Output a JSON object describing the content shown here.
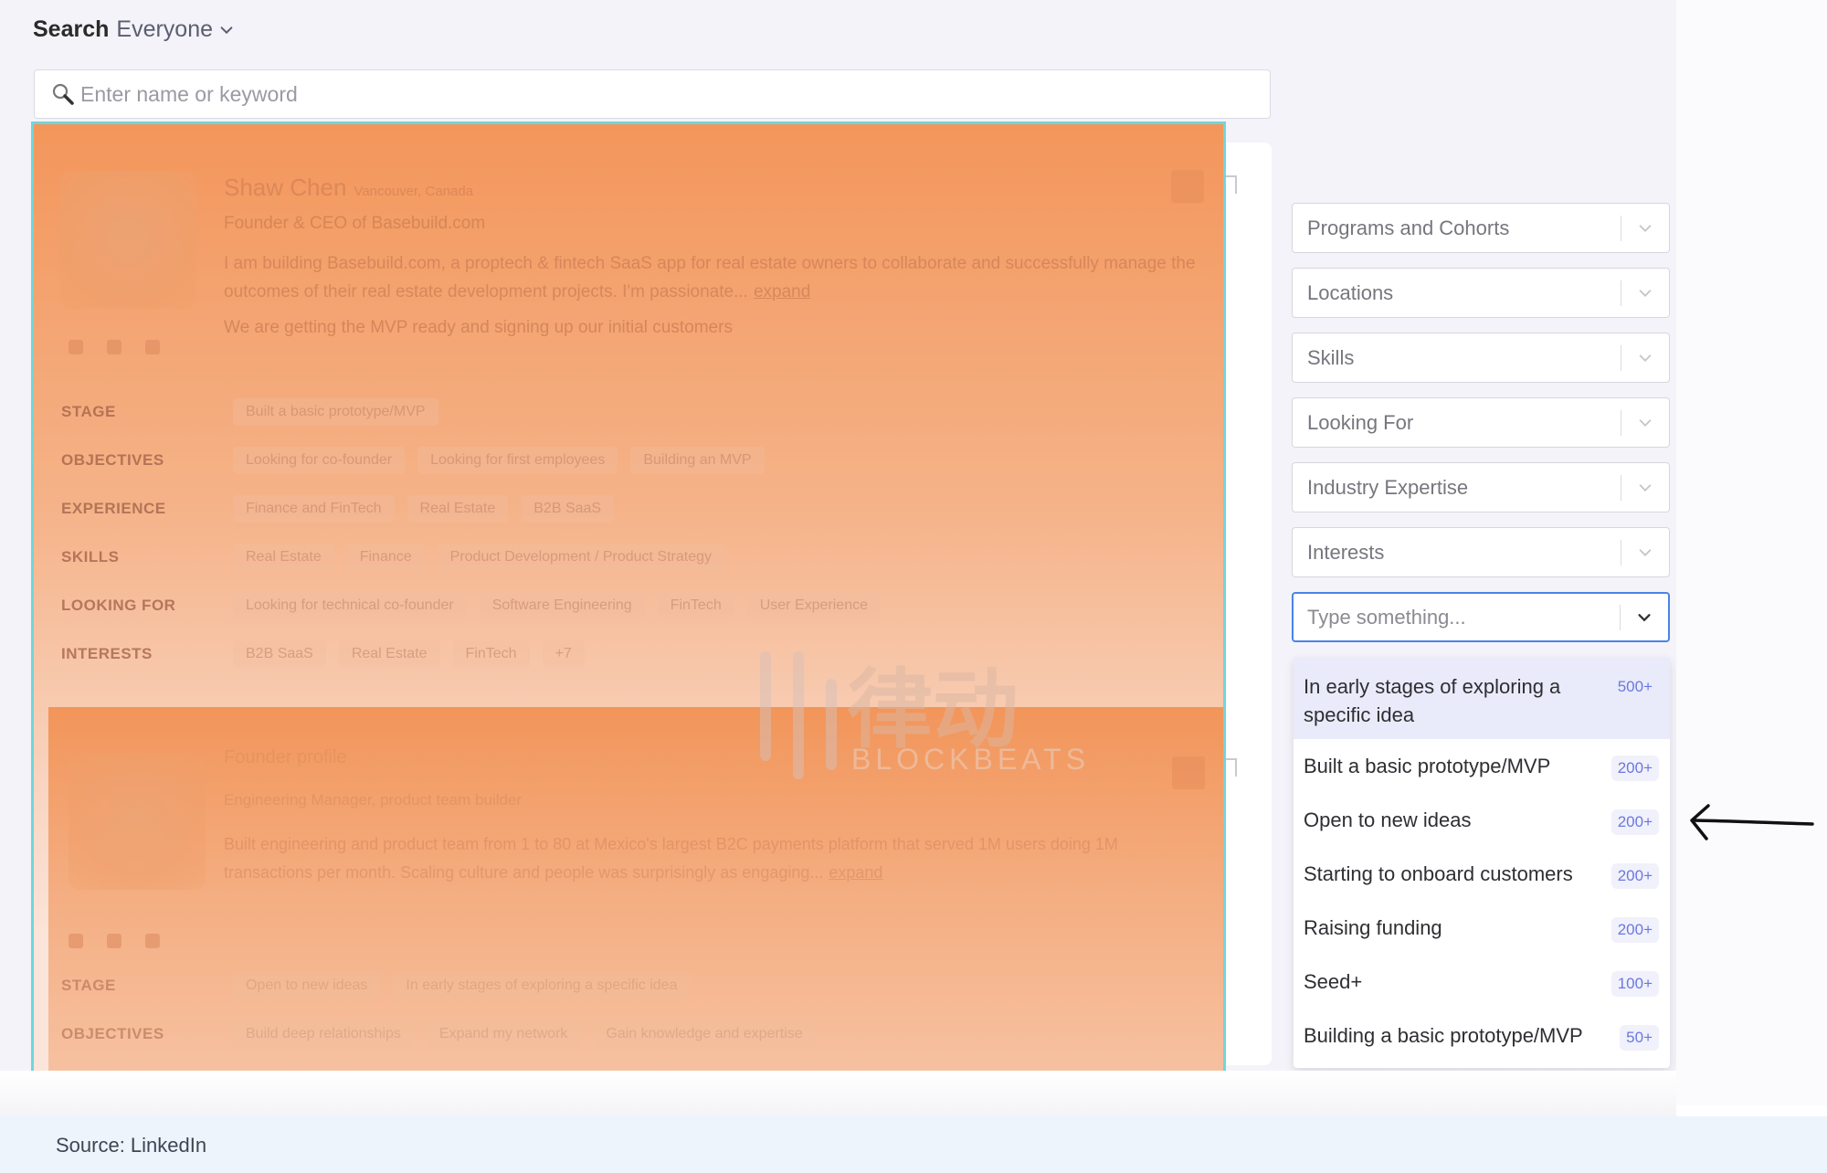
{
  "header": {
    "title": "Search",
    "scope": "Everyone"
  },
  "search": {
    "placeholder": "Enter name or keyword",
    "value": ""
  },
  "profiles": [
    {
      "name": "Shaw Chen",
      "meta": "Vancouver, Canada",
      "headline": "Founder & CEO of Basebuild.com",
      "bio": "I am building Basebuild.com, a proptech & fintech SaaS app for real estate owners to collaborate and successfully manage the outcomes of their real estate development projects. I'm passionate...",
      "more_label": "expand",
      "status": "We are getting the MVP ready and signing up our initial customers",
      "attributes": [
        {
          "label": "STAGE",
          "values": [
            "Built a basic prototype/MVP"
          ]
        },
        {
          "label": "OBJECTIVES",
          "values": [
            "Looking for co-founder",
            "Looking for first employees",
            "Building an MVP"
          ]
        },
        {
          "label": "EXPERIENCE",
          "values": [
            "Finance and FinTech",
            "Real Estate",
            "B2B SaaS"
          ]
        },
        {
          "label": "SKILLS",
          "values": [
            "Real Estate",
            "Finance",
            "Product Development / Product Strategy"
          ]
        },
        {
          "label": "LOOKING FOR",
          "values": [
            "Looking for technical co-founder",
            "Software Engineering",
            "FinTech",
            "User Experience"
          ]
        },
        {
          "label": "INTERESTS",
          "values": [
            "B2B SaaS",
            "Real Estate",
            "FinTech",
            "+7"
          ]
        }
      ]
    },
    {
      "name": "Founder profile",
      "meta": "",
      "headline": "Engineering Manager, product team builder",
      "bio": "Built engineering and product team from 1 to 80 at Mexico's largest B2C payments platform that served 1M users doing 1M transactions per month. Scaling culture and people was surprisingly as engaging...",
      "more_label": "expand",
      "attributes": [
        {
          "label": "STAGE",
          "values": [
            "Open to new ideas",
            "In early stages of exploring a specific idea"
          ]
        },
        {
          "label": "OBJECTIVES",
          "values": [
            "Build deep relationships",
            "Expand my network",
            "Gain knowledge and expertise"
          ]
        }
      ]
    }
  ],
  "watermark": {
    "cn": "律动",
    "en": "BLOCKBEATS"
  },
  "filters": [
    {
      "label": "Programs and Cohorts"
    },
    {
      "label": "Locations"
    },
    {
      "label": "Skills"
    },
    {
      "label": "Looking For"
    },
    {
      "label": "Industry Expertise"
    },
    {
      "label": "Interests"
    }
  ],
  "active_filter": {
    "placeholder": "Type something...",
    "value": ""
  },
  "dropdown_options": [
    {
      "label": "In early stages of exploring a specific idea",
      "count": "500+",
      "highlighted": true
    },
    {
      "label": "Built a basic prototype/MVP",
      "count": "200+"
    },
    {
      "label": "Open to new ideas",
      "count": "200+"
    },
    {
      "label": "Starting to onboard customers",
      "count": "200+"
    },
    {
      "label": "Raising funding",
      "count": "200+"
    },
    {
      "label": "Seed+",
      "count": "100+"
    },
    {
      "label": "Building a basic prototype/MVP",
      "count": "50+"
    }
  ],
  "footer": {
    "source": "Source: LinkedIn"
  },
  "colors": {
    "accent_blue": "#4a84e8",
    "count_badge": "#6b78e0",
    "highlight_outline": "#6fd6da",
    "overlay_orange": "#f3965b"
  }
}
